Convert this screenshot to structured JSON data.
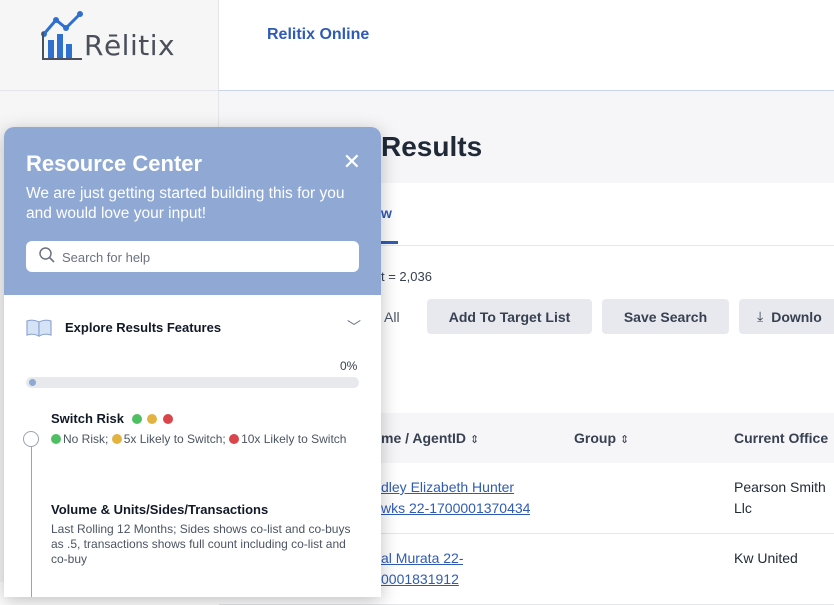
{
  "colors": {
    "accent": "#2f5bb7",
    "panel": "#8fa8d4",
    "risk_green": "#4fbf63",
    "risk_yellow": "#e3b341",
    "risk_red": "#d9454a"
  },
  "brand": {
    "logo_text": "Rēlitix",
    "app_name": "Relitix Online"
  },
  "page": {
    "title": "Results",
    "tab_label": "w",
    "count_text": "t = 2,036"
  },
  "toolbar": {
    "select_all": "All",
    "add_to_target": "Add To Target List",
    "save_search": "Save Search",
    "download": "Downlo"
  },
  "table": {
    "columns": [
      {
        "label": "me / AgentID",
        "sort_icon": "sort-icon"
      },
      {
        "label": "Group",
        "sort_icon": "sort-icon"
      },
      {
        "label": "Current Office"
      }
    ],
    "rows": [
      {
        "name_line1": "dley Elizabeth Hunter",
        "name_line2": "wks 22-1700001370434",
        "group": "",
        "office_line1": "Pearson Smith",
        "office_line2": "Llc"
      },
      {
        "name_line1": "al Murata 22-",
        "name_line2": "0001831912",
        "group": "",
        "office_line1": "",
        "office_line2": "Kw United"
      }
    ]
  },
  "resource_center": {
    "title": "Resource Center",
    "close_glyph": "✕",
    "subtitle": "We are just getting started building this for you and would love your input!",
    "search_placeholder": "Search for help",
    "section_title": "Explore Results Features",
    "progress_text": "0%",
    "progress_value": 0,
    "steps": [
      {
        "title": "Switch Risk",
        "legend_no_risk": "No Risk;",
        "legend_5x": "5x Likely to Switch;",
        "legend_10x": "10x Likely to Switch"
      },
      {
        "title": "Volume & Units/Sides/Transactions",
        "desc": "Last Rolling 12 Months; Sides shows co-list and co-buys as .5, transactions shows full count including co-list and co-buy"
      }
    ]
  }
}
